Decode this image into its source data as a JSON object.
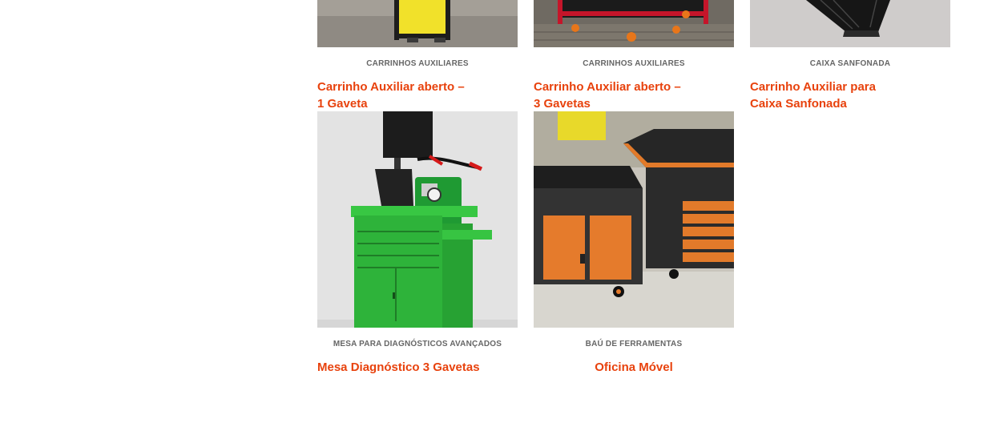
{
  "colors": {
    "accent": "#e8420d",
    "category": "#666666"
  },
  "products": [
    {
      "category": "CARRINHOS AUXILIARES",
      "title_line1": "Carrinho Auxiliar aberto –",
      "title_line2": "1 Gaveta",
      "image": "yellow-cart-photo"
    },
    {
      "category": "CARRINHOS AUXILIARES",
      "title_line1": "Carrinho Auxiliar aberto –",
      "title_line2": "3 Gavetas",
      "image": "red-cart-photo"
    },
    {
      "category": "CAIXA SANFONADA",
      "title_line1": "Carrinho Auxiliar para",
      "title_line2": "Caixa Sanfonada",
      "image": "black-cart-photo"
    },
    {
      "category": "MESA PARA DIAGNÓSTICOS AVANÇADOS",
      "title": "Mesa Diagnóstico 3 Gavetas",
      "image": "green-cabinet-photo"
    },
    {
      "category": "BAÚ DE FERRAMENTAS",
      "title": "Oficina Móvel",
      "image": "orange-toolbox-photo"
    }
  ]
}
